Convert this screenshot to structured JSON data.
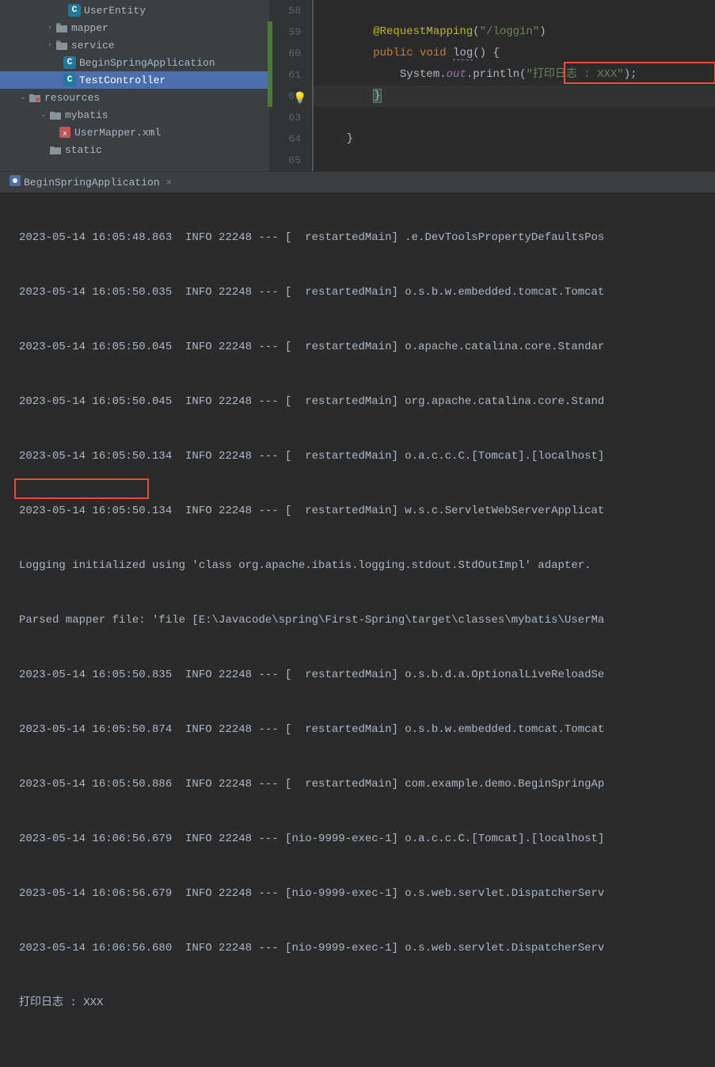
{
  "tree": {
    "userEntity": "UserEntity",
    "mapper": "mapper",
    "service": "service",
    "beginSpring": "BeginSpringApplication",
    "testController": "TestController",
    "resources": "resources",
    "mybatis": "mybatis",
    "userMapperXml": "UserMapper.xml",
    "static": "static"
  },
  "gutter": {
    "l58": "58",
    "l59": "59",
    "l60": "60",
    "l61": "61",
    "l62": "62",
    "l63": "63",
    "l64": "64",
    "l65": "65"
  },
  "code": {
    "annotation": "@RequestMapping",
    "annotationArg": "\"/loggin\"",
    "kwPublic": "public",
    "kwVoid": "void",
    "methodName": "log",
    "sysClass": "System",
    "sysOut": "out",
    "println": "println",
    "printArg": "\"打印日志 : XXX\"",
    "openBrace": "{",
    "closeBrace": "}",
    "closeBrace2": "}"
  },
  "runTab": {
    "title": "BeginSpringApplication"
  },
  "console": {
    "l0": "2023-05-14 16:05:48.863  INFO 22248 --- [  restartedMain] .e.DevToolsPropertyDefaultsPos",
    "l1": "2023-05-14 16:05:50.035  INFO 22248 --- [  restartedMain] o.s.b.w.embedded.tomcat.Tomcat",
    "l2": "2023-05-14 16:05:50.045  INFO 22248 --- [  restartedMain] o.apache.catalina.core.Standar",
    "l3": "2023-05-14 16:05:50.045  INFO 22248 --- [  restartedMain] org.apache.catalina.core.Stand",
    "l4": "2023-05-14 16:05:50.134  INFO 22248 --- [  restartedMain] o.a.c.c.C.[Tomcat].[localhost]",
    "l5": "2023-05-14 16:05:50.134  INFO 22248 --- [  restartedMain] w.s.c.ServletWebServerApplicat",
    "l6": "Logging initialized using 'class org.apache.ibatis.logging.stdout.StdOutImpl' adapter.",
    "l7": "Parsed mapper file: 'file [E:\\Javacode\\spring\\First-Spring\\target\\classes\\mybatis\\UserMa",
    "l8": "2023-05-14 16:05:50.835  INFO 22248 --- [  restartedMain] o.s.b.d.a.OptionalLiveReloadSe",
    "l9": "2023-05-14 16:05:50.874  INFO 22248 --- [  restartedMain] o.s.b.w.embedded.tomcat.Tomcat",
    "l10": "2023-05-14 16:05:50.886  INFO 22248 --- [  restartedMain] com.example.demo.BeginSpringAp",
    "l11": "2023-05-14 16:06:56.679  INFO 22248 --- [nio-9999-exec-1] o.a.c.c.C.[Tomcat].[localhost]",
    "l12": "2023-05-14 16:06:56.679  INFO 22248 --- [nio-9999-exec-1] o.s.web.servlet.DispatcherServ",
    "l13": "2023-05-14 16:06:56.680  INFO 22248 --- [nio-9999-exec-1] o.s.web.servlet.DispatcherServ",
    "l14": "打印日志 : XXX"
  }
}
